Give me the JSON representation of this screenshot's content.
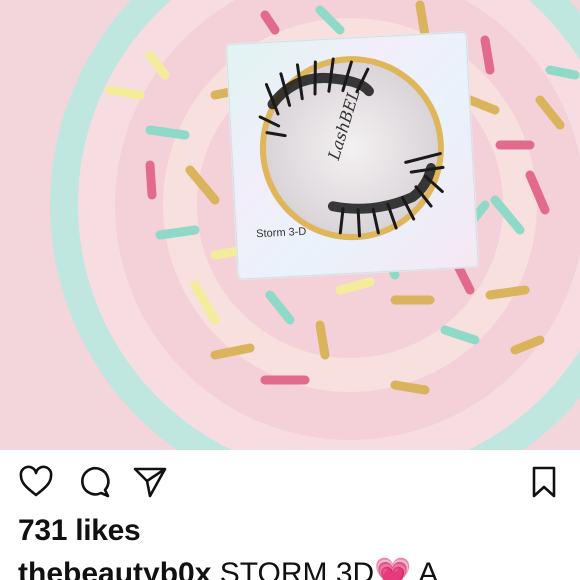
{
  "post": {
    "product_label": "Storm 3-D",
    "brand_script": "LashBEL"
  },
  "actions": {
    "like_icon": "heart-outline-icon",
    "comment_icon": "speech-bubble-icon",
    "share_icon": "paper-plane-icon",
    "save_icon": "bookmark-icon"
  },
  "likes": {
    "text": "731 likes"
  },
  "caption": {
    "username": "thebeautyb0x",
    "text": " STORM 3D",
    "emoji": "💗",
    "tail": " A"
  },
  "colors": {
    "background_pink": "#f3d6dc",
    "donut_rim": "#bfe6df",
    "icing": "#f6cfd4",
    "gold_ring": "#e0b65a"
  }
}
